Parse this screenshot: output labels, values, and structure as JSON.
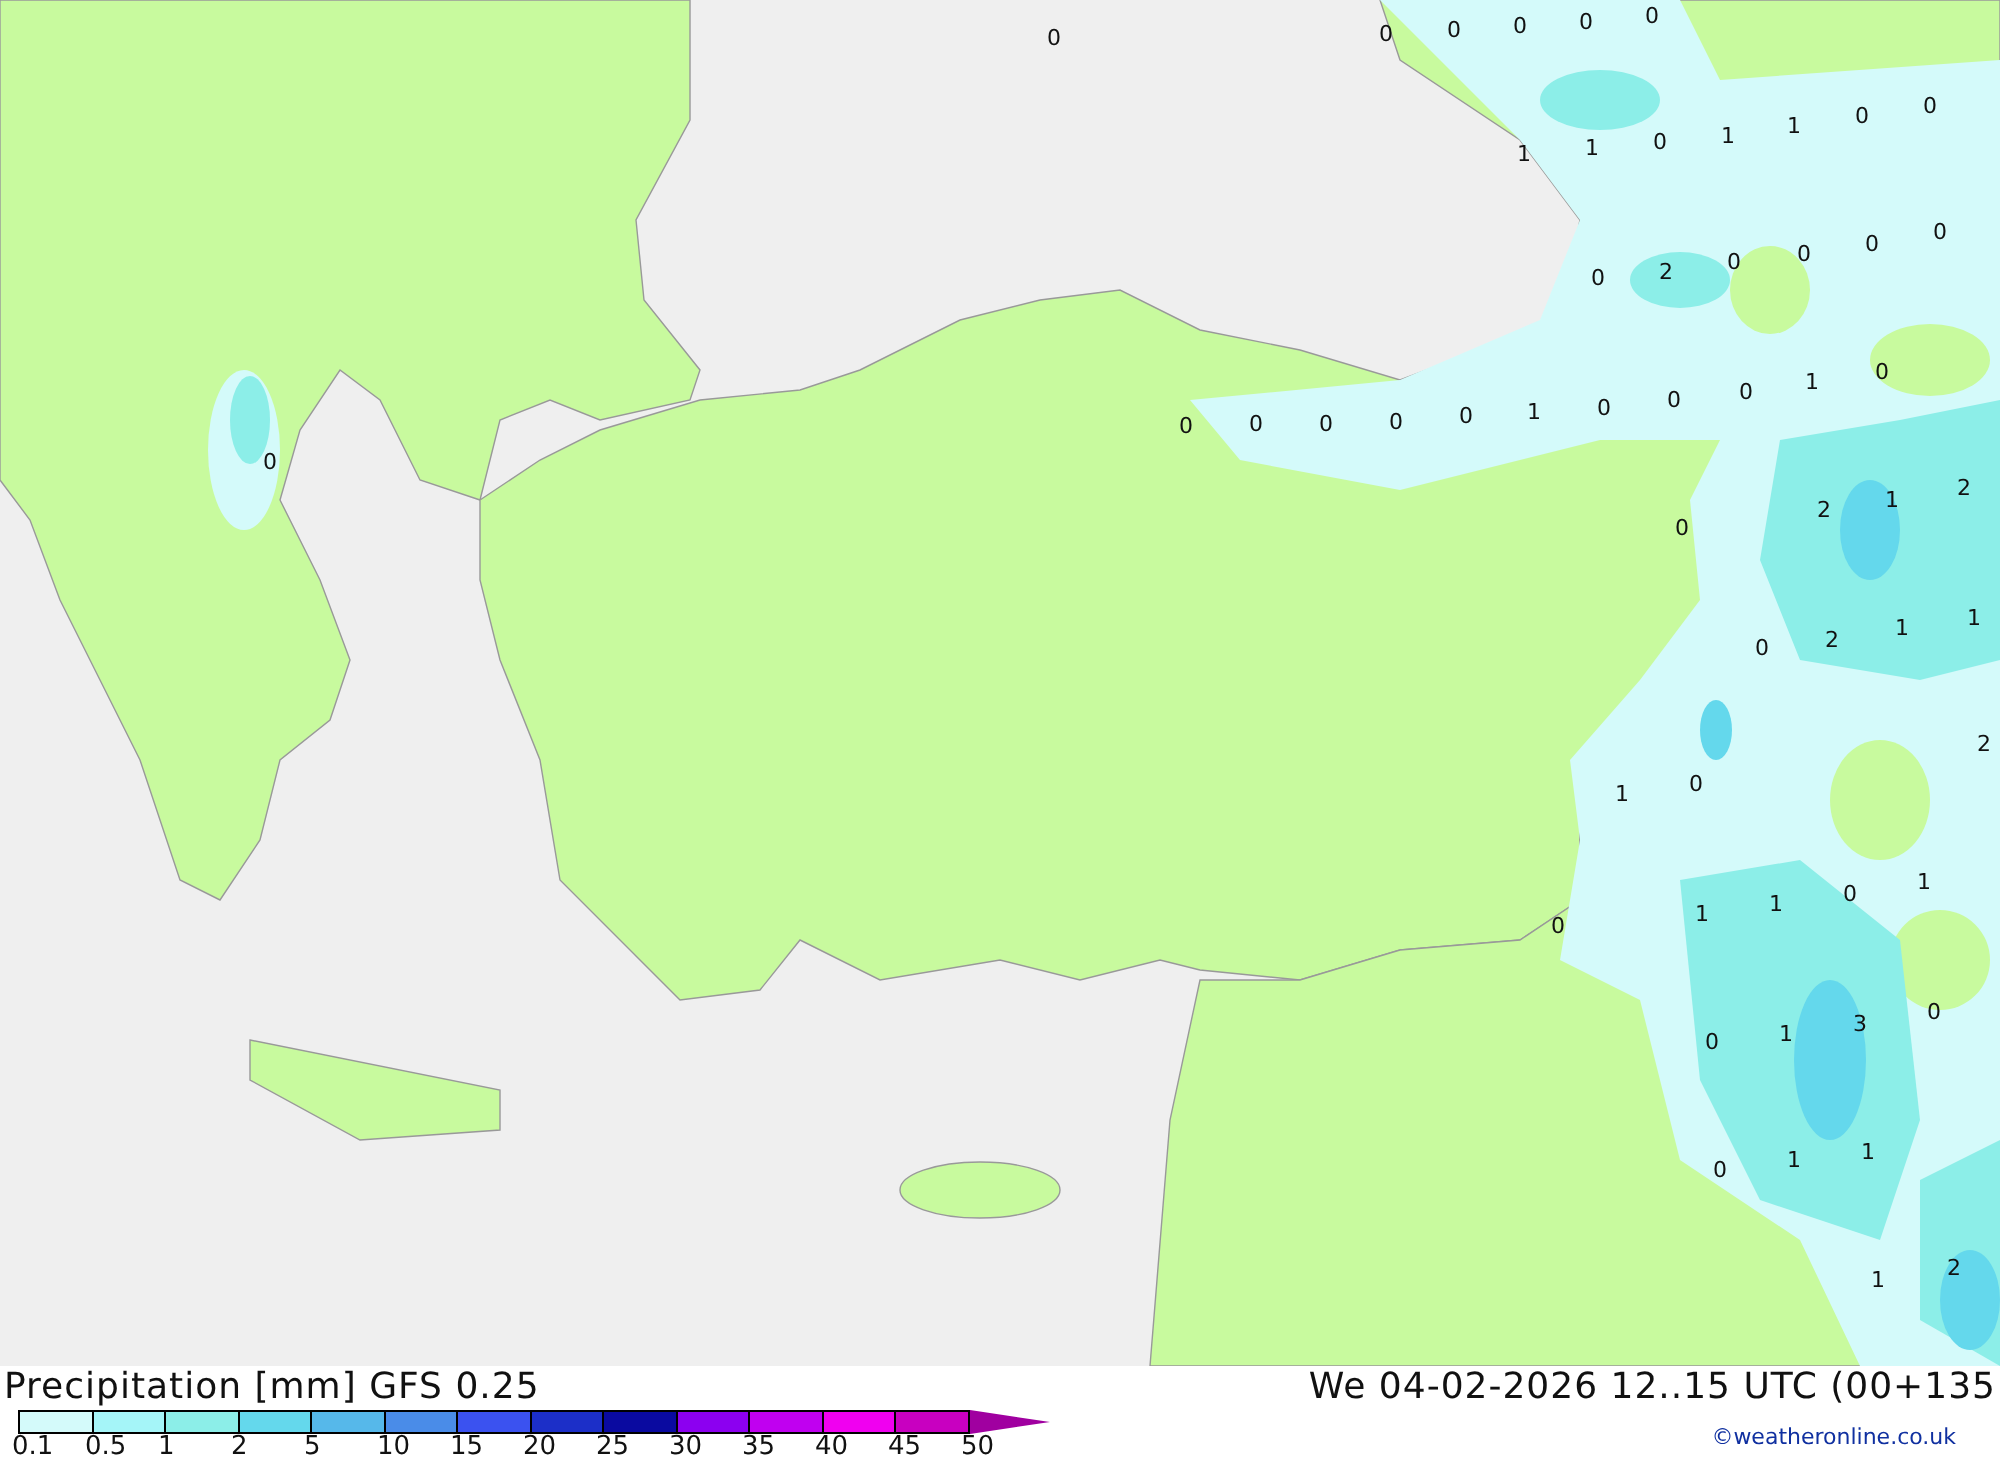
{
  "map": {
    "values": [
      {
        "text": "0"
      },
      {
        "text": "0"
      },
      {
        "text": "0"
      },
      {
        "text": "0"
      },
      {
        "text": "0"
      },
      {
        "text": "0"
      },
      {
        "text": "1"
      },
      {
        "text": "1"
      },
      {
        "text": "0"
      },
      {
        "text": "1"
      },
      {
        "text": "1"
      },
      {
        "text": "0"
      },
      {
        "text": "0"
      },
      {
        "text": "0"
      },
      {
        "text": "2"
      },
      {
        "text": "0"
      },
      {
        "text": "0"
      },
      {
        "text": "0"
      },
      {
        "text": "0"
      },
      {
        "text": "0"
      },
      {
        "text": "1"
      },
      {
        "text": "0"
      },
      {
        "text": "0"
      },
      {
        "text": "0"
      },
      {
        "text": "0"
      },
      {
        "text": "0"
      },
      {
        "text": "0"
      },
      {
        "text": "1"
      },
      {
        "text": "0"
      },
      {
        "text": "0"
      },
      {
        "text": "0"
      },
      {
        "text": "2"
      },
      {
        "text": "1"
      },
      {
        "text": "2"
      },
      {
        "text": "0"
      },
      {
        "text": "0"
      },
      {
        "text": "2"
      },
      {
        "text": "1"
      },
      {
        "text": "1"
      },
      {
        "text": "2"
      },
      {
        "text": "1"
      },
      {
        "text": "0"
      },
      {
        "text": "0"
      },
      {
        "text": "1"
      },
      {
        "text": "1"
      },
      {
        "text": "1"
      },
      {
        "text": "0"
      },
      {
        "text": "0"
      },
      {
        "text": "1"
      },
      {
        "text": "3"
      },
      {
        "text": "0"
      },
      {
        "text": "0"
      },
      {
        "text": "1"
      },
      {
        "text": "1"
      },
      {
        "text": "1"
      },
      {
        "text": "2"
      }
    ]
  },
  "footer": {
    "title": "Precipitation [mm] GFS 0.25",
    "time": "We 04-02-2026 12..15 UTC (00+135",
    "credit": "©weatheronline.co.uk",
    "legend": {
      "boxes": [
        {
          "color": "#d4fafa"
        },
        {
          "color": "#a5f5f8"
        },
        {
          "color": "#8ceee8"
        },
        {
          "color": "#64d8ec"
        },
        {
          "color": "#56b8ea"
        },
        {
          "color": "#4a8ce8"
        },
        {
          "color": "#3b52f0"
        },
        {
          "color": "#1c2fc8"
        },
        {
          "color": "#0a0aa0"
        },
        {
          "color": "#8c00f0"
        },
        {
          "color": "#c000f0"
        },
        {
          "color": "#f000f0"
        },
        {
          "color": "#c800c0"
        },
        {
          "kind": "arrow",
          "color": "#a000a0"
        }
      ],
      "labels": [
        "0.1",
        "0.5",
        "1",
        "2",
        "5",
        "10",
        "15",
        "20",
        "25",
        "30",
        "35",
        "40",
        "45",
        "50"
      ]
    }
  }
}
